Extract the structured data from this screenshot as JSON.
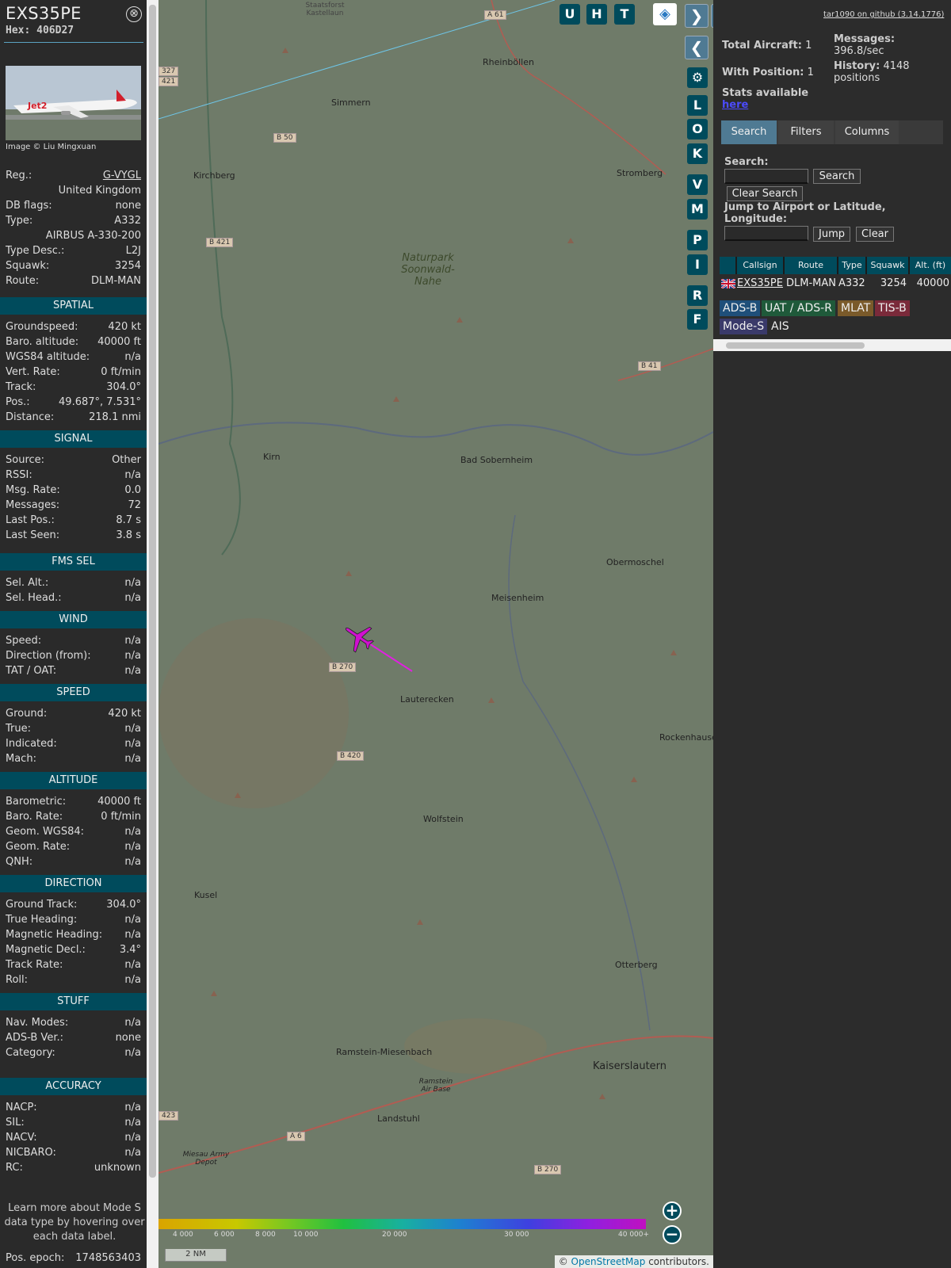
{
  "selected": {
    "callsign": "EXS35PE",
    "hex": "Hex: 406D27",
    "close": "⊗",
    "image_credit": "Image © Liu Mingxuan",
    "info": [
      {
        "k": "Reg.:",
        "v": "G-VYGL"
      },
      {
        "k": "",
        "v": "United Kingdom"
      },
      {
        "k": "DB flags:",
        "v": "none"
      },
      {
        "k": "Type:",
        "v": "A332"
      },
      {
        "k": "",
        "v": "AIRBUS A-330-200"
      },
      {
        "k": "Type Desc.:",
        "v": "L2J"
      },
      {
        "k": "Squawk:",
        "v": "3254"
      },
      {
        "k": "Route:",
        "v": "DLM-MAN"
      }
    ],
    "sections": {
      "spatial": "SPATIAL",
      "signal": "SIGNAL",
      "fms": "FMS SEL",
      "wind": "WIND",
      "speed": "SPEED",
      "altitude": "ALTITUDE",
      "direction": "DIRECTION",
      "stuff": "STUFF",
      "accuracy": "ACCURACY"
    },
    "spatial": [
      {
        "k": "Groundspeed:",
        "v": "420 kt"
      },
      {
        "k": "Baro. altitude:",
        "v": "40000 ft"
      },
      {
        "k": "WGS84 altitude:",
        "v": "n/a"
      },
      {
        "k": "Vert. Rate:",
        "v": "0 ft/min"
      },
      {
        "k": "Track:",
        "v": "304.0°"
      },
      {
        "k": "Pos.:",
        "v": "49.687°, 7.531°"
      },
      {
        "k": "Distance:",
        "v": "218.1 nmi"
      }
    ],
    "signal": [
      {
        "k": "Source:",
        "v": "Other"
      },
      {
        "k": "RSSI:",
        "v": "n/a"
      },
      {
        "k": "Msg. Rate:",
        "v": "0.0"
      },
      {
        "k": "Messages:",
        "v": "72"
      },
      {
        "k": "Last Pos.:",
        "v": "8.7 s"
      },
      {
        "k": "Last Seen:",
        "v": "3.8 s"
      }
    ],
    "fms": [
      {
        "k": "Sel. Alt.:",
        "v": "n/a"
      },
      {
        "k": "Sel. Head.:",
        "v": "n/a"
      }
    ],
    "wind": [
      {
        "k": "Speed:",
        "v": "n/a"
      },
      {
        "k": "Direction (from):",
        "v": "n/a"
      },
      {
        "k": "TAT / OAT:",
        "v": "n/a"
      }
    ],
    "speed": [
      {
        "k": "Ground:",
        "v": "420 kt"
      },
      {
        "k": "True:",
        "v": "n/a"
      },
      {
        "k": "Indicated:",
        "v": "n/a"
      },
      {
        "k": "Mach:",
        "v": "n/a"
      }
    ],
    "altitude": [
      {
        "k": "Barometric:",
        "v": "40000 ft"
      },
      {
        "k": "Baro. Rate:",
        "v": "0 ft/min"
      },
      {
        "k": "Geom. WGS84:",
        "v": "n/a"
      },
      {
        "k": "Geom. Rate:",
        "v": "n/a"
      },
      {
        "k": "QNH:",
        "v": "n/a"
      }
    ],
    "direction": [
      {
        "k": "Ground Track:",
        "v": "304.0°"
      },
      {
        "k": "True Heading:",
        "v": "n/a"
      },
      {
        "k": "Magnetic Heading:",
        "v": "n/a"
      },
      {
        "k": "Magnetic Decl.:",
        "v": "3.4°"
      },
      {
        "k": "Track Rate:",
        "v": "n/a"
      },
      {
        "k": "Roll:",
        "v": "n/a"
      }
    ],
    "stuff": [
      {
        "k": "Nav. Modes:",
        "v": "n/a"
      },
      {
        "k": "ADS-B Ver.:",
        "v": "none"
      },
      {
        "k": "Category:",
        "v": "n/a"
      }
    ],
    "accuracy": [
      {
        "k": "NACP:",
        "v": "n/a"
      },
      {
        "k": "SIL:",
        "v": "n/a"
      },
      {
        "k": "NACV:",
        "v": "n/a"
      },
      {
        "k": "NICBARO:",
        "v": "n/a"
      },
      {
        "k": "RC:",
        "v": "unknown"
      }
    ],
    "note": "Learn more about Mode S data type by hovering over each data label.",
    "epoch_label": "Pos. epoch:",
    "epoch_value": "1748563403"
  },
  "map": {
    "buttons_top": [
      "U",
      "H",
      "T"
    ],
    "side_buttons": [
      "L",
      "O",
      "K",
      "V",
      "M",
      "P",
      "I",
      "R",
      "F"
    ],
    "places": [
      "Rheinböllen",
      "Simmern",
      "Kirchberg",
      "Stromberg",
      "Naturpark Soonwald-Nahe",
      "Kirn",
      "Bad Sobernheim",
      "Obermoschel",
      "Meisenheim",
      "Lauterecken",
      "Rockenhausen",
      "Wolfstein",
      "Kusel",
      "Otterberg",
      "Ramstein-Miesenbach",
      "Kaiserslautern",
      "Landstuhl",
      "Ramstein Air Base",
      "Miesau Army Depot",
      "Staatsforst Kastellaun"
    ],
    "roads": [
      "A 61",
      "B 50",
      "B 421",
      "B 41",
      "B 270",
      "B 420",
      "A 6",
      "B 270",
      "327",
      "421",
      "423"
    ],
    "altitude_scale": [
      "4 000",
      "6 000",
      "8 000",
      "10 000",
      "20 000",
      "30 000",
      "40 000+"
    ],
    "scale_bar": "2 NM",
    "attribution_prefix": "©",
    "attribution_link": "OpenStreetMap",
    "attribution_suffix": "contributors."
  },
  "right": {
    "github": "tar1090 on github (3.14.1776)",
    "total_aircraft_label": "Total Aircraft:",
    "total_aircraft": "1",
    "with_position_label": "With Position:",
    "with_position": "1",
    "messages_label": "Messages:",
    "messages": "396.8/sec",
    "history_label": "History:",
    "history": "4148 positions",
    "stats_label": "Stats available",
    "stats_link": "here",
    "tabs": [
      "Search",
      "Filters",
      "Columns"
    ],
    "search_label": "Search:",
    "search_button": "Search",
    "clear_search_button": "Clear Search",
    "jump_label": "Jump to Airport or Latitude, Longitude:",
    "jump_button": "Jump",
    "clear_button": "Clear",
    "columns": [
      "Callsign",
      "Route",
      "Type",
      "Squawk",
      "Alt. (ft)"
    ],
    "row": {
      "callsign": "EXS35PE",
      "route": "DLM-MAN",
      "type": "A332",
      "squawk": "3254",
      "alt": "40000"
    },
    "sources": [
      "ADS-B",
      "UAT / ADS-R",
      "MLAT",
      "TIS-B",
      "Mode-S",
      "AIS"
    ],
    "colors": {
      "adsb": "#1f4f7a",
      "uat": "#1f5a3a",
      "mlat": "#7a5a2a",
      "tisb": "#7a2a3a",
      "modes": "#3a3a6a"
    }
  }
}
